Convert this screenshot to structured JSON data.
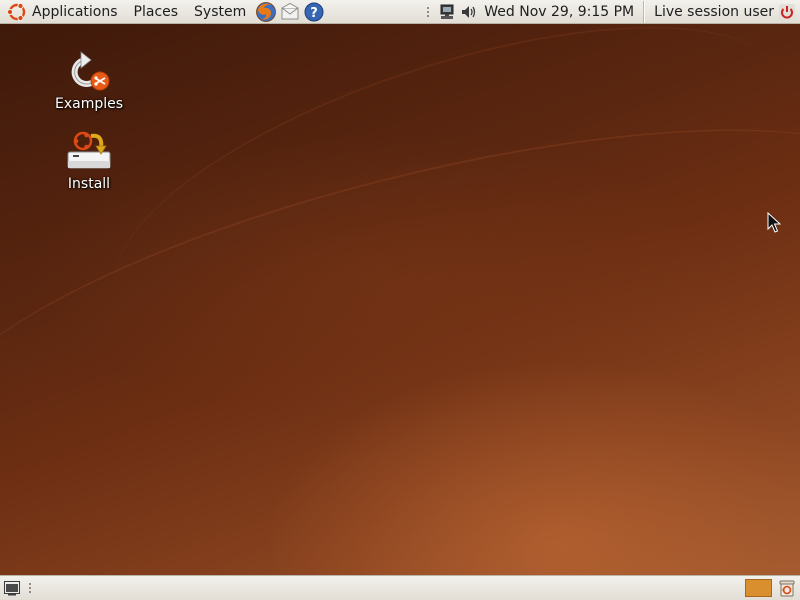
{
  "top_panel": {
    "menus": {
      "applications": "Applications",
      "places": "Places",
      "system": "System"
    },
    "launchers": [
      "firefox-icon",
      "mail-icon",
      "help-icon"
    ],
    "tray_icons": [
      "network-icon",
      "volume-icon"
    ],
    "clock": "Wed Nov 29,  9:15 PM",
    "user": "Live session user"
  },
  "desktop": {
    "icons": [
      {
        "label": "Examples",
        "icon": "examples-icon"
      },
      {
        "label": "Install",
        "icon": "install-icon"
      }
    ]
  },
  "bottom_panel": {
    "show_desktop_icon": "show-desktop-icon",
    "workspace_color": "#d98f2e",
    "trash_icon": "trash-icon"
  },
  "colors": {
    "panel_bg": "#ebe8e2",
    "wallpaper": "#6e2f13",
    "ubuntu_orange": "#dd4814"
  }
}
